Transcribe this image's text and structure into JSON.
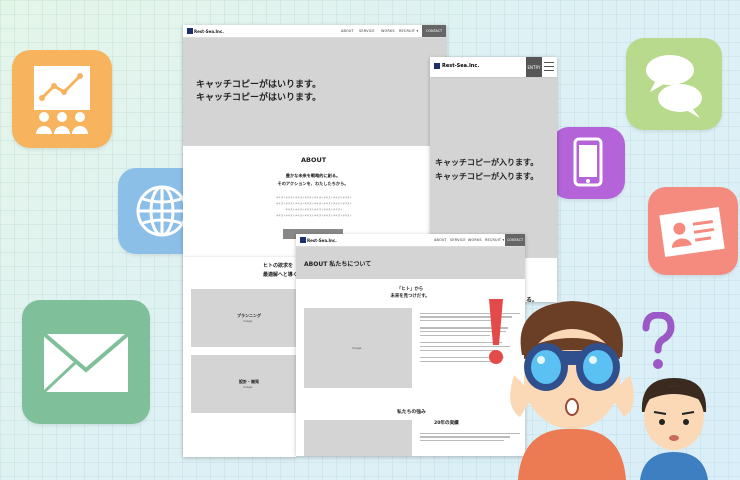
{
  "page_a": {
    "logo": "Rest-Sea.Inc.",
    "nav": [
      "ABOUT",
      "SERVICE",
      "WORKS",
      "RECRUIT ▾"
    ],
    "contact": "CONTACT",
    "hero_line1": "キャッチコピーがはいります。",
    "hero_line2": "キャッチコピーがはいります。",
    "about_heading": "ABOUT",
    "about_lead1": "豊かな未来を戦略的に創る。",
    "about_lead2": "そのアクションを、わたしたちから。",
    "about_body": [
      "テキストテキストテキストテキストテキストテキストテキストテキスト",
      "テキストテキストテキストテキストテキストテキストテキストテキスト",
      "テキストテキストテキストテキストテキストテキスト",
      "テキストテキストテキストテキストテキストテキストテキストテキスト"
    ],
    "section2_line1": "ヒトの欲求を",
    "section2_line2": "最適解へと導く",
    "card1_title": "プランニング",
    "card1_image": "image",
    "card2_title": "設計・開発",
    "card2_image": "image"
  },
  "page_b": {
    "logo": "Rest-Sea.Inc.",
    "entry": "ENTRY",
    "line1": "キャッチコピーが入ります。",
    "line2": "キャッチコピーが入ります。",
    "partial": "る。"
  },
  "page_c": {
    "logo": "Rest-Sea.Inc.",
    "nav": [
      "ABOUT",
      "SERVICE",
      "WORKS",
      "RECRUIT ▾"
    ],
    "contact": "CONTACT",
    "page_title": "ABOUT 私たちについて",
    "lead1": "「ヒト」から",
    "lead2": "未来を見つけだす。",
    "image1": "Image",
    "section_strength": "私たちの強み",
    "section_years": "20年の実績"
  },
  "colors": {
    "tile_orange": "#f8b35e",
    "tile_blue": "#8cbfe8",
    "tile_green": "#7fc09a",
    "tile_lime": "#b8da8c",
    "tile_purple": "#b463d8",
    "tile_salmon": "#f58b7e"
  },
  "icons": [
    "presentation-icon",
    "globe-icon",
    "mail-icon",
    "chat-bubbles-icon",
    "smartphone-icon",
    "id-card-icon"
  ]
}
